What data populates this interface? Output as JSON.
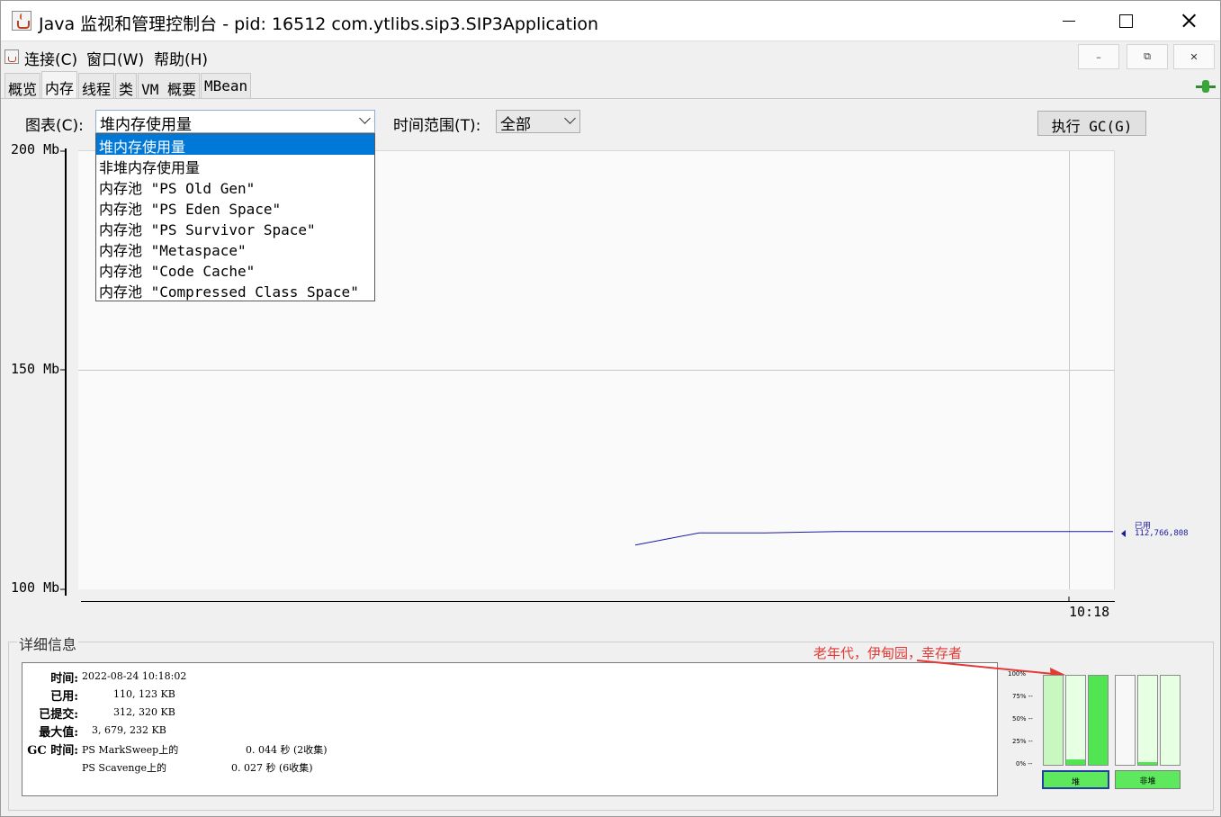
{
  "window": {
    "title": "Java 监视和管理控制台 - pid: 16512 com.ytlibs.sip3.SIP3Application"
  },
  "menu": {
    "items": [
      "连接(C)",
      "窗口(W)",
      "帮助(H)"
    ],
    "mdi_minimize": "–",
    "mdi_restore": "⧉",
    "mdi_close": "✕"
  },
  "tabs": [
    "概览",
    "内存",
    "线程",
    "类",
    "VM 概要",
    "MBean"
  ],
  "active_tab": "内存",
  "controls": {
    "chart_label": "图表(C):",
    "chart_selected": "堆内存使用量",
    "time_range_label": "时间范围(T):",
    "time_range_selected": "全部",
    "gc_button": "执行 GC(G)"
  },
  "dropdown": {
    "options": [
      "堆内存使用量",
      "非堆内存使用量",
      "内存池 \"PS Old Gen\"",
      "内存池 \"PS Eden Space\"",
      "内存池 \"PS Survivor Space\"",
      "内存池 \"Metaspace\"",
      "内存池 \"Code Cache\"",
      "内存池 \"Compressed Class Space\""
    ],
    "selected_index": 0
  },
  "chart_data": {
    "type": "line",
    "y_tick_labels": [
      "200 Mb",
      "150 Mb",
      "100 Mb"
    ],
    "y_ticks": [
      200,
      150,
      100
    ],
    "ylim": [
      100,
      200
    ],
    "x_tick_labels": [
      "10:18"
    ],
    "series": [
      {
        "name": "已用",
        "color": "#1a1aa0",
        "current_value_label": "112,766,808",
        "values": [
          110.1,
          112.9,
          112.9,
          113.2,
          113.2,
          113.2
        ]
      }
    ]
  },
  "details": {
    "title": "详细信息",
    "rows": [
      {
        "key": "时间:",
        "value": "2022-08-24 10:18:02"
      },
      {
        "key": "已用:",
        "value": "110, 123 KB"
      },
      {
        "key": "已提交:",
        "value": "312, 320 KB"
      },
      {
        "key": "最大值:",
        "value": "3, 679, 232 KB"
      }
    ],
    "gc_key": "GC 时间:",
    "gc_rows": [
      {
        "name": "PS MarkSweep上的",
        "value": "0. 044 秒 (2收集)"
      },
      {
        "name": "PS Scavenge上的",
        "value": "0. 027 秒 (6收集)"
      }
    ]
  },
  "annotation": "老年代，伊甸园，幸存者",
  "pools": {
    "pct_labels": [
      "100%",
      "75% --",
      "50% --",
      "25% --",
      "0% --"
    ],
    "heap_label": "堆",
    "nonheap_label": "非堆",
    "heap_bars": [
      0.0,
      0.06,
      1.0
    ],
    "nonheap_bars": [
      0.0,
      0.03,
      0.0
    ]
  }
}
